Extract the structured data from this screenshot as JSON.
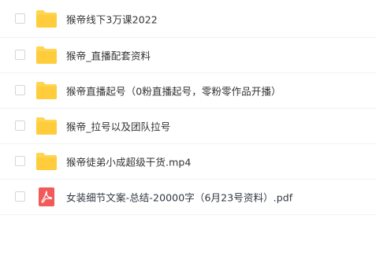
{
  "files": [
    {
      "name": "猴帝线下3万课2022",
      "type": "folder",
      "icon": "folder-icon",
      "color": "#ffd451"
    },
    {
      "name": "猴帝_直播配套资料",
      "type": "folder",
      "icon": "folder-icon",
      "color": "#ffd451"
    },
    {
      "name": "猴帝直播起号（0粉直播起号，零粉零作品开播）",
      "type": "folder",
      "icon": "folder-icon",
      "color": "#ffd451"
    },
    {
      "name": "猴帝_拉号以及团队拉号",
      "type": "folder",
      "icon": "folder-icon",
      "color": "#ffd451"
    },
    {
      "name": "猴帝徒弟小成超级干货.mp4",
      "type": "folder",
      "icon": "folder-icon",
      "color": "#ffd451"
    },
    {
      "name": "女装细节文案-总结-20000字（6月23号资料）.pdf",
      "type": "pdf",
      "icon": "pdf-icon",
      "color": "#f25a5a"
    }
  ]
}
